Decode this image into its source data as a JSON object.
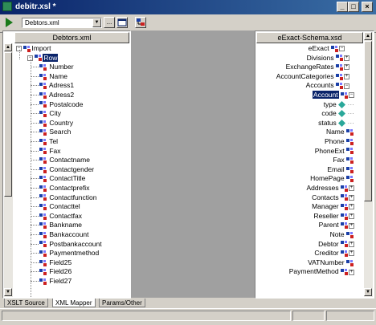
{
  "window": {
    "title": "debitr.xsl *",
    "minimize": "_",
    "maximize": "□",
    "close": "×"
  },
  "toolbar": {
    "file_select_value": "Debtors.xml",
    "browse_label": "...",
    "colors": {
      "run": "#1a7a1a"
    }
  },
  "left_panel": {
    "header": "Debtors.xml",
    "root_label": "Import",
    "row_label": "Row",
    "fields": [
      "Number",
      "Name",
      "Adress1",
      "Adress2",
      "Postalcode",
      "City",
      "Country",
      "Search",
      "Tel",
      "Fax",
      "Contactname",
      "Contactgender",
      "ContactTitle",
      "Contactprefix",
      "Contactfunction",
      "Contacttel",
      "Contactfax",
      "Bankname",
      "Bankaccount",
      "Postbankaccount",
      "Paymentmethod",
      "Field25",
      "Field26",
      "Field27"
    ]
  },
  "right_panel": {
    "header": "eExact-Schema.xsd",
    "items": [
      {
        "label": "eExact",
        "expander": "-"
      },
      {
        "label": "Divisions",
        "expander": "+"
      },
      {
        "label": "ExchangeRates",
        "expander": "+"
      },
      {
        "label": "AccountCategories",
        "expander": "+"
      },
      {
        "label": "Accounts",
        "expander": "-"
      },
      {
        "label": "Account",
        "expander": "-",
        "selected": true
      },
      {
        "label": "type",
        "kind": "attr"
      },
      {
        "label": "code",
        "kind": "attr"
      },
      {
        "label": "status",
        "kind": "attr"
      },
      {
        "label": "Name",
        "expander": ""
      },
      {
        "label": "Phone",
        "expander": ""
      },
      {
        "label": "PhoneExt",
        "expander": ""
      },
      {
        "label": "Fax",
        "expander": ""
      },
      {
        "label": "Email",
        "expander": ""
      },
      {
        "label": "HomePage",
        "expander": ""
      },
      {
        "label": "Addresses",
        "expander": "+"
      },
      {
        "label": "Contacts",
        "expander": "+"
      },
      {
        "label": "Manager",
        "expander": "+"
      },
      {
        "label": "Reseller",
        "expander": "+"
      },
      {
        "label": "Parent",
        "expander": "+"
      },
      {
        "label": "Note",
        "expander": ""
      },
      {
        "label": "Debtor",
        "expander": "+"
      },
      {
        "label": "Creditor",
        "expander": "+"
      },
      {
        "label": "VATNumber",
        "expander": ""
      },
      {
        "label": "PaymentMethod",
        "expander": "+"
      }
    ]
  },
  "tabs": [
    "XSLT Source",
    "XML Mapper",
    "Params/Other"
  ],
  "active_tab": 1
}
